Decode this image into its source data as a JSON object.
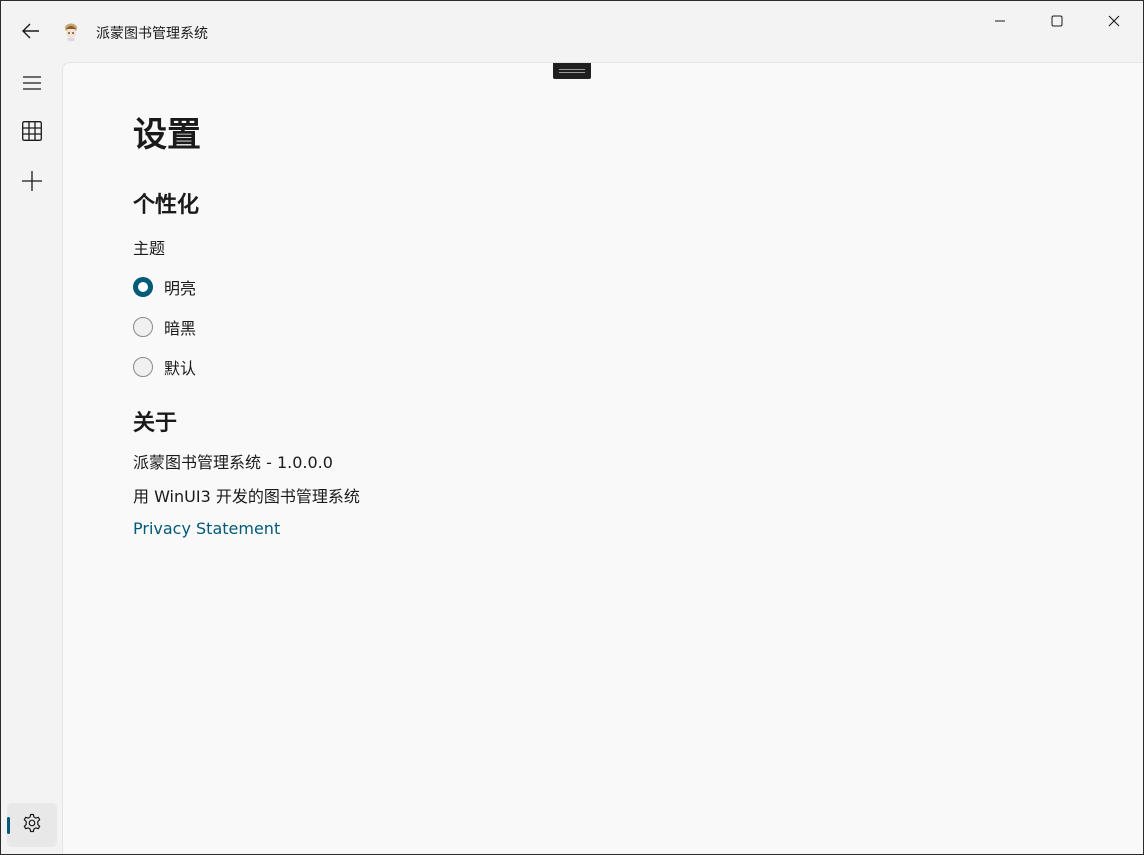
{
  "titlebar": {
    "app_title": "派蒙图书管理系统",
    "back_icon": "back-arrow-icon",
    "minimize_icon": "minimize-icon",
    "maximize_icon": "maximize-icon",
    "close_icon": "close-icon"
  },
  "nav": {
    "items": [
      {
        "icon": "hamburger-menu-icon"
      },
      {
        "icon": "grid-icon"
      },
      {
        "icon": "add-icon"
      }
    ],
    "settings": {
      "icon": "gear-icon",
      "selected": true
    }
  },
  "settings_page": {
    "title": "设置",
    "personalization": {
      "heading": "个性化",
      "theme_label": "主题",
      "options": [
        {
          "label": "明亮",
          "checked": true
        },
        {
          "label": "暗黑",
          "checked": false
        },
        {
          "label": "默认",
          "checked": false
        }
      ]
    },
    "about": {
      "heading": "关于",
      "version_line": "派蒙图书管理系统 - 1.0.0.0",
      "description": "用 WinUI3 开发的图书管理系统",
      "privacy_link": "Privacy Statement"
    }
  },
  "colors": {
    "accent": "#005a78",
    "window_bg": "#f3f3f3",
    "content_bg": "#f9f9f9",
    "text": "#1a1a1a"
  }
}
